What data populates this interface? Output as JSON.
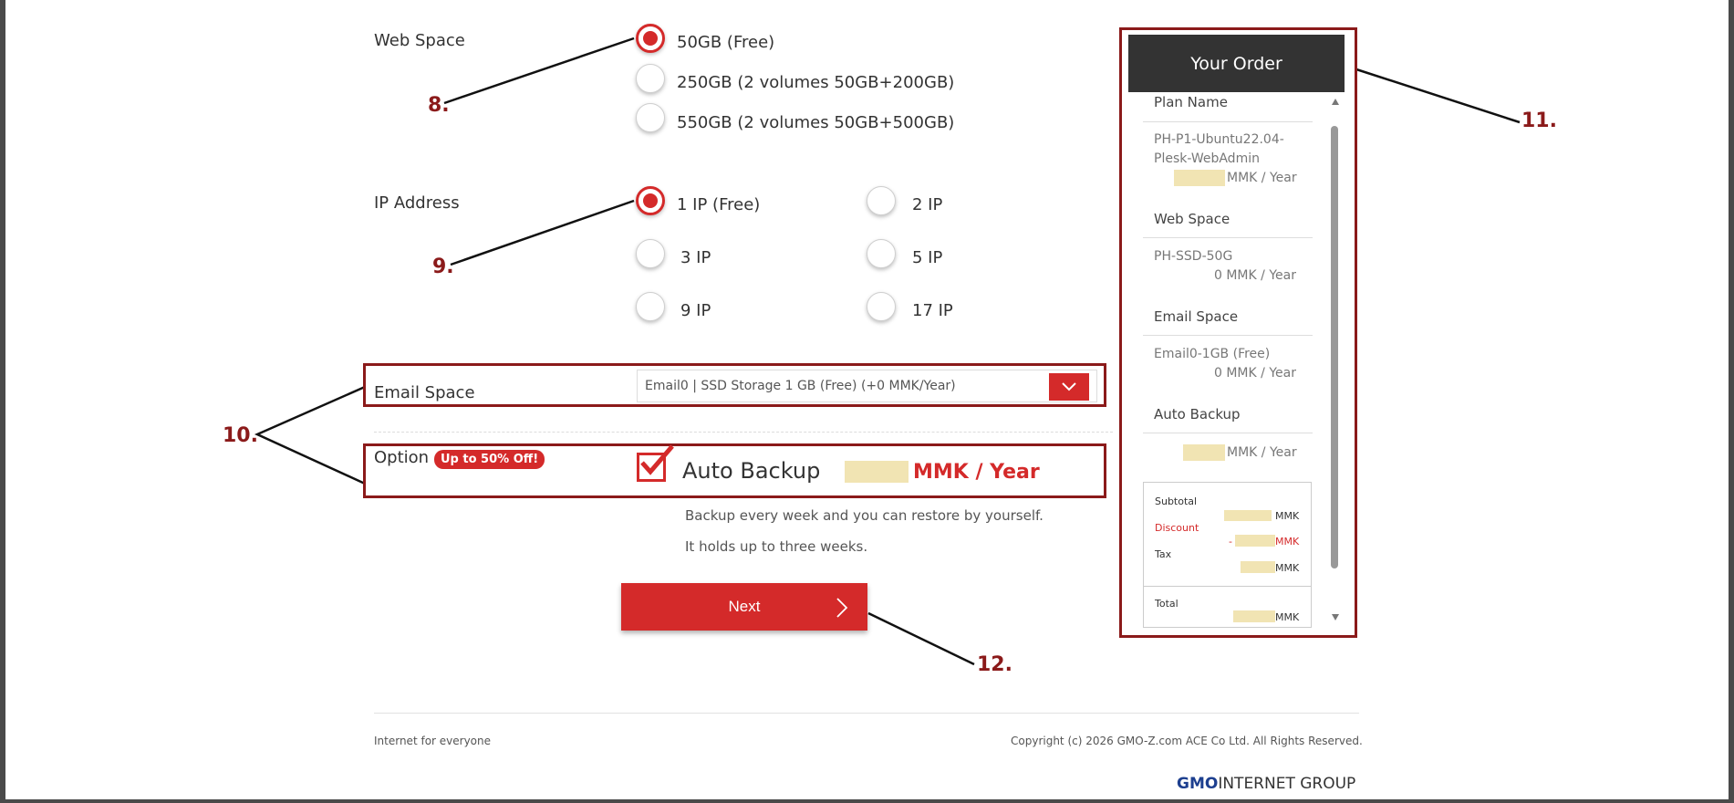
{
  "web_space": {
    "label": "Web Space",
    "options": [
      {
        "label": "50GB (Free)",
        "selected": true
      },
      {
        "label": "250GB (2 volumes 50GB+200GB)",
        "selected": false
      },
      {
        "label": "550GB (2 volumes 50GB+500GB)",
        "selected": false
      }
    ]
  },
  "ip_address": {
    "label": "IP Address",
    "options": [
      {
        "label": "1 IP (Free)",
        "selected": true
      },
      {
        "label": "2 IP",
        "selected": false
      },
      {
        "label": "3 IP",
        "selected": false
      },
      {
        "label": "5 IP",
        "selected": false
      },
      {
        "label": "9 IP",
        "selected": false
      },
      {
        "label": "17 IP",
        "selected": false
      }
    ]
  },
  "email_space": {
    "label": "Email Space",
    "selected": "Email0 | SSD Storage 1 GB (Free) (+0 MMK/Year)"
  },
  "option": {
    "label": "Option",
    "badge": "Up to 50% Off!",
    "auto_backup": {
      "label": "Auto Backup",
      "checked": true,
      "price_unit": "MMK / Year",
      "desc1": "Backup every week and you can restore by yourself.",
      "desc2": "It holds up to three weeks."
    }
  },
  "next_button": "Next",
  "order": {
    "title": "Your Order",
    "plan_name_label": "Plan Name",
    "plan_name_line1": "PH-P1-Ubuntu22.04-",
    "plan_name_line2": "Plesk-WebAdmin",
    "plan_price_unit": "MMK / Year",
    "web_space_label": "Web Space",
    "web_space_value": "PH-SSD-50G",
    "web_space_price": "0 MMK / Year",
    "email_space_label": "Email Space",
    "email_space_value": "Email0-1GB (Free)",
    "email_space_price": "0 MMK / Year",
    "auto_backup_label": "Auto Backup",
    "auto_backup_price_unit": "MMK / Year",
    "subtotal_label": "Subtotal",
    "subtotal_unit": "MMK",
    "discount_label": "Discount",
    "discount_prefix": "-",
    "discount_unit": "MMK",
    "tax_label": "Tax",
    "tax_unit": "MMK",
    "total_label": "Total",
    "total_unit": "MMK"
  },
  "annotations": [
    "8.",
    "9.",
    "10.",
    "11.",
    "12."
  ],
  "footer": {
    "left": "Internet for everyone",
    "right": "Copyright (c) 2026 GMO-Z.com ACE Co Ltd. All Rights Reserved.",
    "logo_bold": "GMO",
    "logo_rest": "INTERNET GROUP"
  },
  "colors": {
    "accent": "#d42a2a",
    "annotation": "#8b1a1a",
    "redacted": "#f1e4b3"
  }
}
